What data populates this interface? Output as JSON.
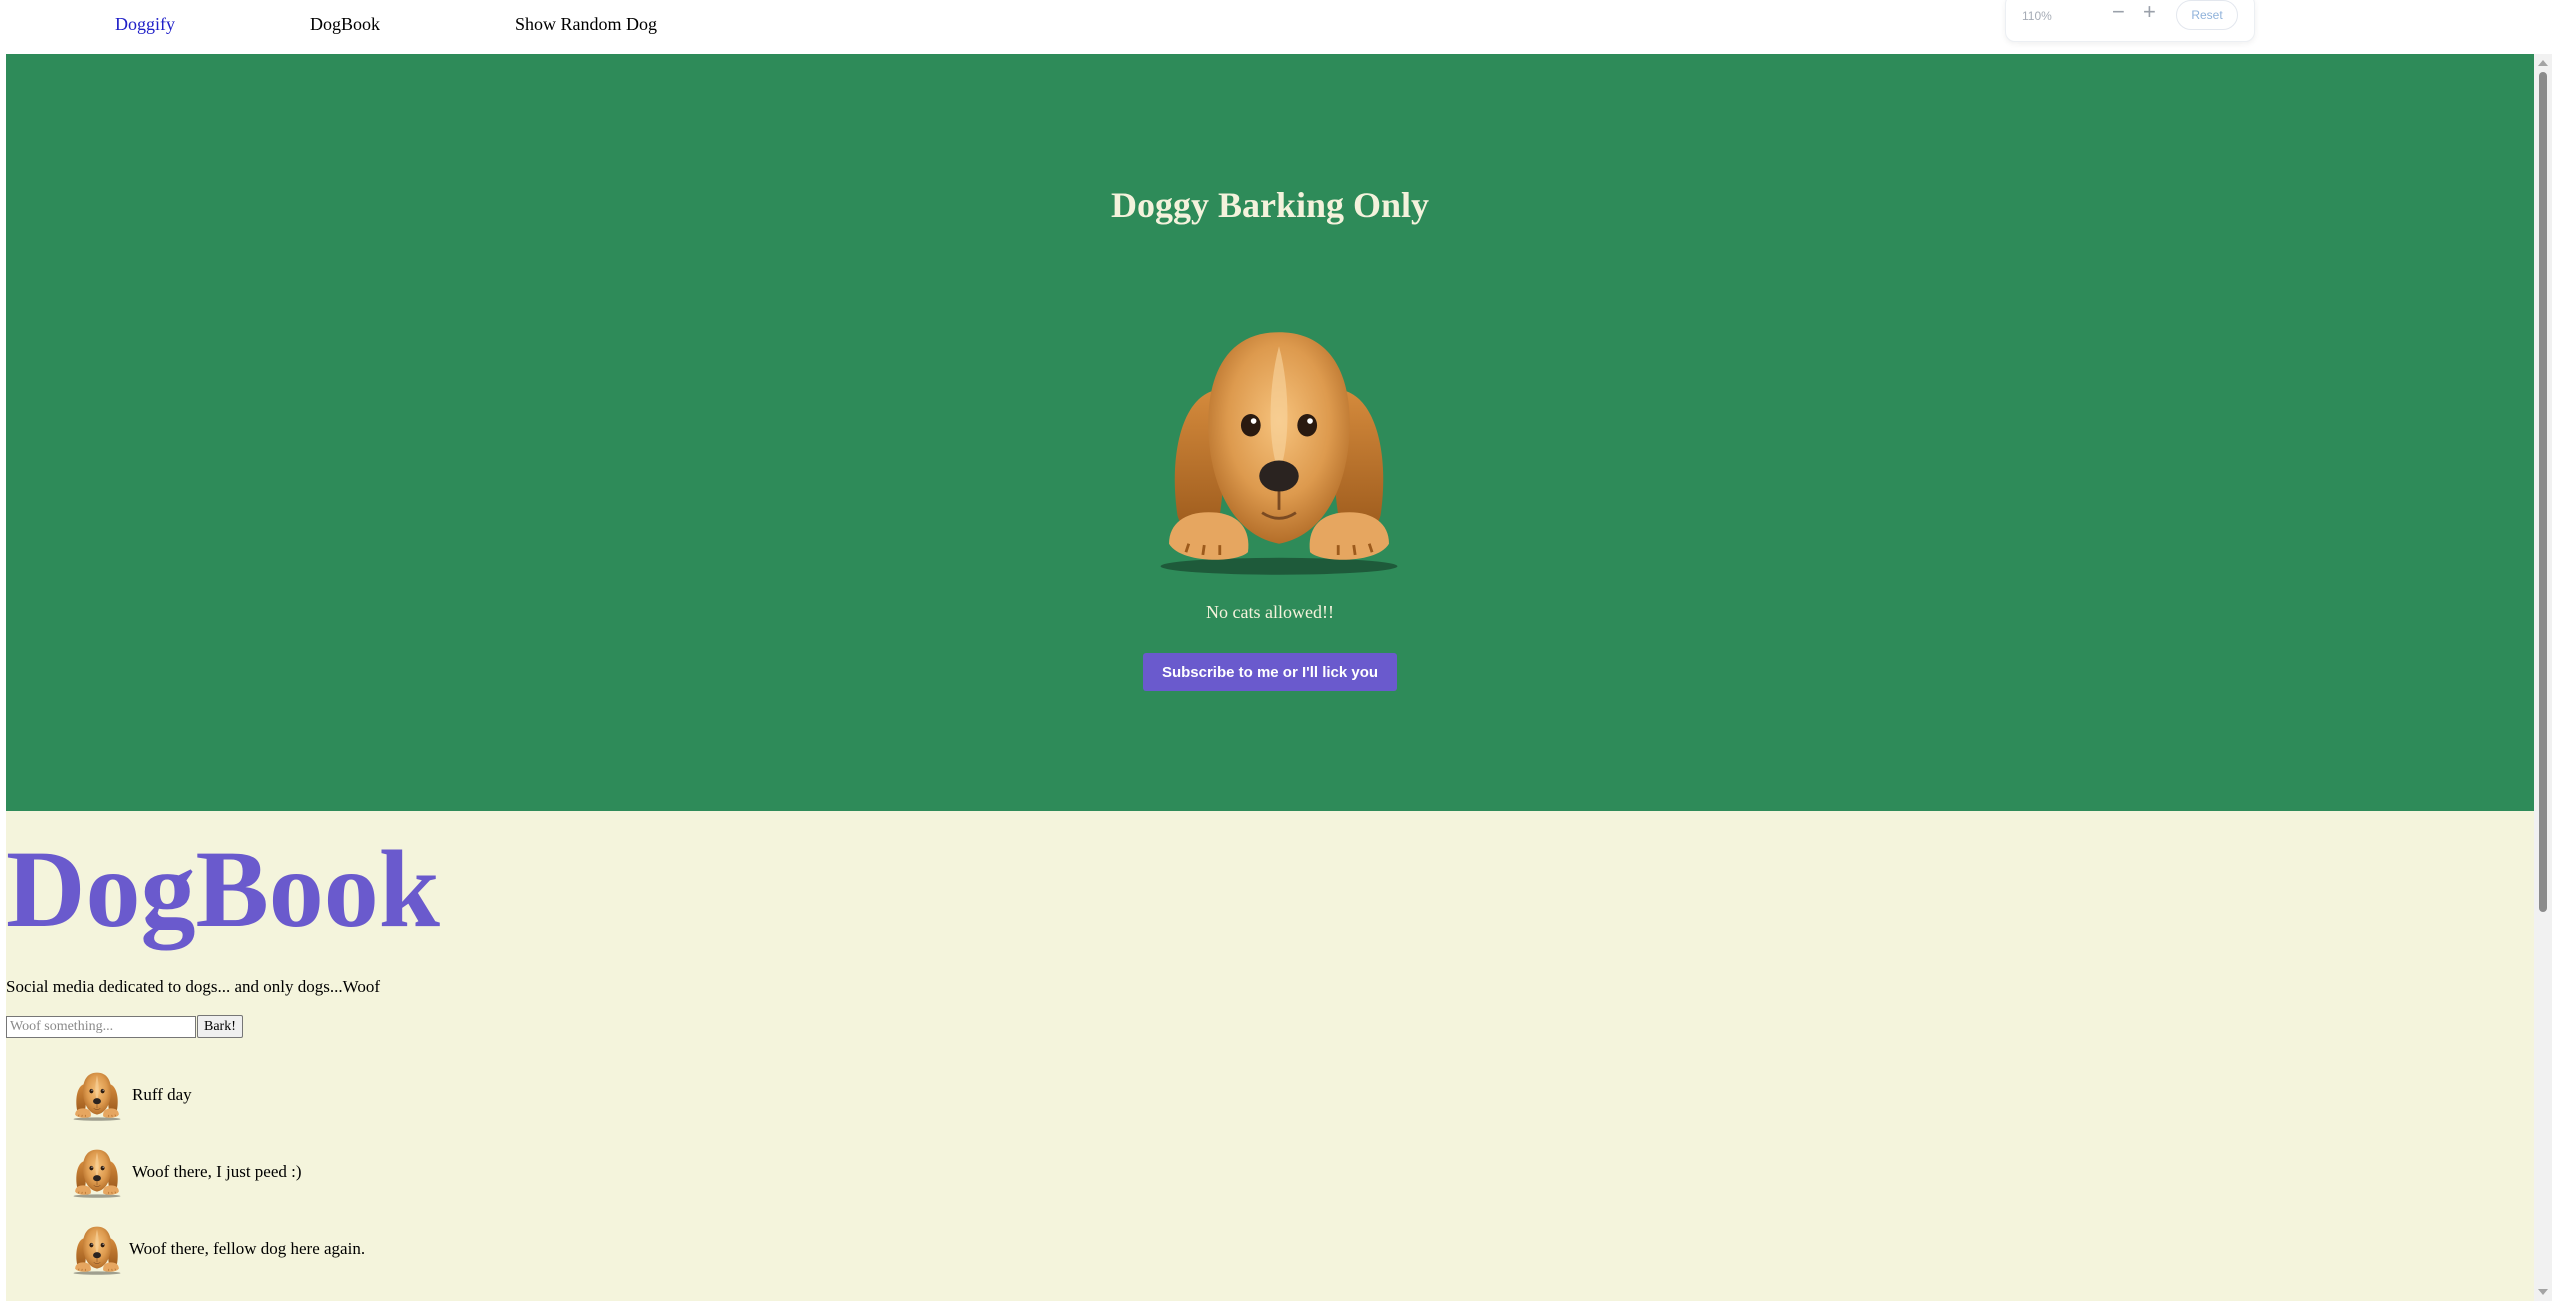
{
  "nav": {
    "items": [
      {
        "label": "Doggify",
        "active": true
      },
      {
        "label": "DogBook",
        "active": false
      },
      {
        "label": "Show Random Dog",
        "active": false
      }
    ]
  },
  "zoom": {
    "level": "110%",
    "minus": "−",
    "plus": "+",
    "reset": "Reset"
  },
  "hero": {
    "title": "Doggy Barking Only",
    "tagline": "No cats allowed!!",
    "button": "Subscribe to me or I'll lick you",
    "background": "#2e8b59",
    "text_color": "#f4f2dc",
    "button_color": "#6a5acd"
  },
  "dogbook": {
    "title": "DogBook",
    "description": "Social media dedicated to dogs... and only dogs...Woof",
    "input_placeholder": "Woof something...",
    "submit": "Bark!",
    "background": "#f4f4dc",
    "posts": [
      {
        "text": "Ruff day"
      },
      {
        "text": "Woof there, I just peed :)"
      },
      {
        "text": "Woof there, fellow dog here again."
      }
    ]
  }
}
